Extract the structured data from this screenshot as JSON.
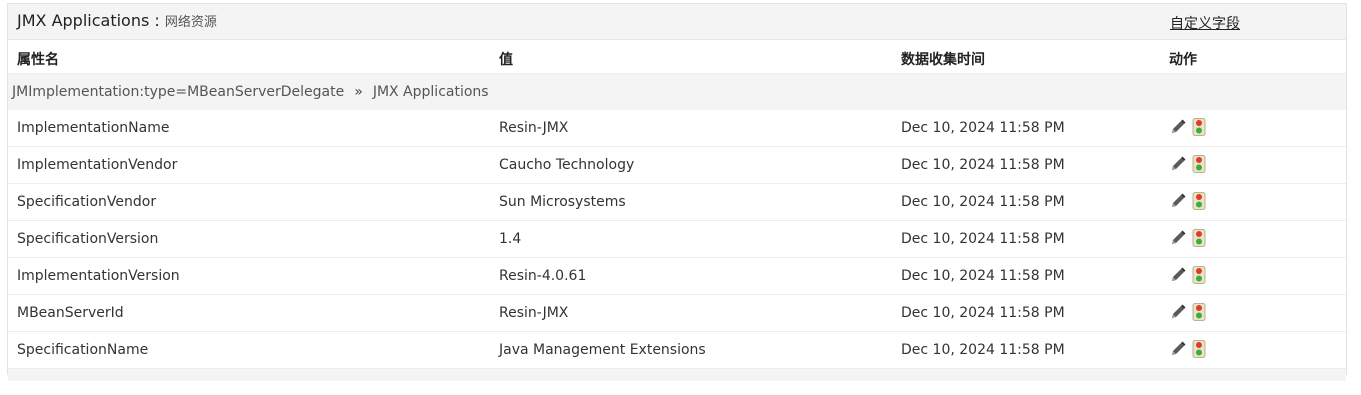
{
  "header": {
    "title": "JMX Applications",
    "separator": " : ",
    "subtitle": "网络资源",
    "custom_field_link": "自定义字段"
  },
  "columns": {
    "name": "属性名",
    "value": "值",
    "time": "数据收集时间",
    "action": "动作"
  },
  "group": {
    "mbean": "JMImplementation:type=MBeanServerDelegate",
    "separator": "»",
    "app": "JMX Applications"
  },
  "rows": [
    {
      "name": "ImplementationName",
      "value": "Resin-JMX",
      "time": "Dec 10, 2024 11:58 PM"
    },
    {
      "name": "ImplementationVendor",
      "value": "Caucho Technology",
      "time": "Dec 10, 2024 11:58 PM"
    },
    {
      "name": "SpecificationVendor",
      "value": "Sun Microsystems",
      "time": "Dec 10, 2024 11:58 PM"
    },
    {
      "name": "SpecificationVersion",
      "value": "1.4",
      "time": "Dec 10, 2024 11:58 PM"
    },
    {
      "name": "ImplementationVersion",
      "value": "Resin-4.0.61",
      "time": "Dec 10, 2024 11:58 PM"
    },
    {
      "name": "MBeanServerId",
      "value": "Resin-JMX",
      "time": "Dec 10, 2024 11:58 PM"
    },
    {
      "name": "SpecificationName",
      "value": "Java Management Extensions",
      "time": "Dec 10, 2024 11:58 PM"
    }
  ],
  "icons": {
    "edit": "pencil-icon",
    "threshold": "traffic-light-icon"
  },
  "colors": {
    "header_bg": "#f4f4f4",
    "pencil": "#555555",
    "light_red": "#e03a2f",
    "light_green": "#3cae3c"
  }
}
